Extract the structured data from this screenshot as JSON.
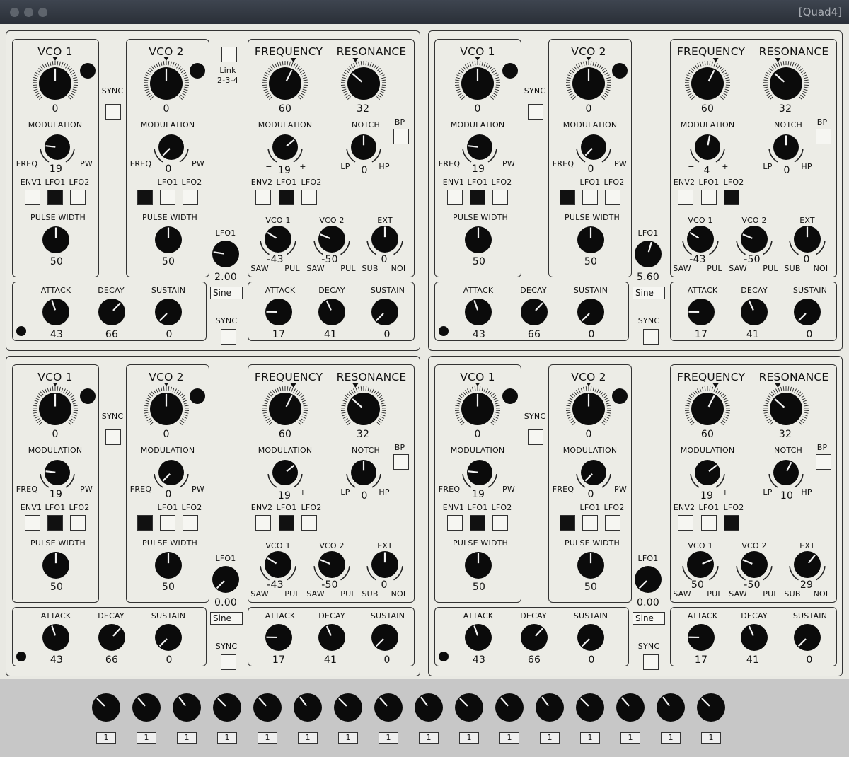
{
  "window": {
    "title": "[Quad4]"
  },
  "labels": {
    "vco1": "VCO 1",
    "vco2": "VCO 2",
    "sync": "SYNC",
    "modulation": "MODULATION",
    "freq": "FREQ",
    "pw": "PW",
    "env1": "ENV1",
    "env2": "ENV2",
    "lfo1": "LFO1",
    "lfo2": "LFO2",
    "pulse_width": "PULSE WIDTH",
    "frequency": "FREQUENCY",
    "resonance": "RESONANCE",
    "notch": "NOTCH",
    "bp": "BP",
    "minus": "−",
    "plus": "+",
    "lp": "LP",
    "hp": "HP",
    "ext": "EXT",
    "saw": "SAW",
    "pul": "PUL",
    "sub": "SUB",
    "noi": "NOI",
    "attack": "ATTACK",
    "decay": "DECAY",
    "sustain": "SUSTAIN",
    "link": "Link",
    "link_sub": "2-3-4"
  },
  "voices": [
    {
      "vco1": "0",
      "vco2": "0",
      "mod1": "19",
      "mod2": "0",
      "pw1": "50",
      "pw2": "50",
      "mod1_src": [
        false,
        true,
        false
      ],
      "mod2_src": [
        true,
        false,
        false
      ],
      "freq": "60",
      "res": "32",
      "fmod": "19",
      "notch": "0",
      "fsrc": [
        false,
        true,
        false
      ],
      "mix_vco1": "-43",
      "mix_vco2": "-50",
      "mix_ext": "0",
      "env1": [
        "43",
        "66",
        "0"
      ],
      "env2": [
        "17",
        "41",
        "0"
      ],
      "lfo_rate": "2.00",
      "lfo_shape": "Sine",
      "lfo_label": "LFO1",
      "sync": "SYNC"
    },
    {
      "vco1": "0",
      "vco2": "0",
      "mod1": "19",
      "mod2": "0",
      "pw1": "50",
      "pw2": "50",
      "mod1_src": [
        false,
        true,
        false
      ],
      "mod2_src": [
        true,
        false,
        false
      ],
      "freq": "60",
      "res": "32",
      "fmod": "4",
      "notch": "0",
      "fsrc": [
        false,
        false,
        true
      ],
      "mix_vco1": "-43",
      "mix_vco2": "-50",
      "mix_ext": "0",
      "env1": [
        "43",
        "66",
        "0"
      ],
      "env2": [
        "17",
        "41",
        "0"
      ],
      "lfo_rate": "5.60",
      "lfo_shape": "Sine",
      "lfo_label": "LFO1",
      "sync": "SYNC"
    },
    {
      "vco1": "0",
      "vco2": "0",
      "mod1": "19",
      "mod2": "0",
      "pw1": "50",
      "pw2": "50",
      "mod1_src": [
        false,
        true,
        false
      ],
      "mod2_src": [
        true,
        false,
        false
      ],
      "freq": "60",
      "res": "32",
      "fmod": "19",
      "notch": "0",
      "fsrc": [
        false,
        true,
        false
      ],
      "mix_vco1": "-43",
      "mix_vco2": "-50",
      "mix_ext": "0",
      "env1": [
        "43",
        "66",
        "0"
      ],
      "env2": [
        "17",
        "41",
        "0"
      ],
      "lfo_rate": "0.00",
      "lfo_shape": "Sine",
      "lfo_label": "LFO1",
      "sync": "SYNC"
    },
    {
      "vco1": "0",
      "vco2": "0",
      "mod1": "19",
      "mod2": "0",
      "pw1": "50",
      "pw2": "50",
      "mod1_src": [
        false,
        true,
        false
      ],
      "mod2_src": [
        true,
        false,
        false
      ],
      "freq": "60",
      "res": "32",
      "fmod": "19",
      "notch": "10",
      "fsrc": [
        false,
        false,
        true
      ],
      "mix_vco1": "50",
      "mix_vco2": "-50",
      "mix_ext": "29",
      "env1": [
        "43",
        "66",
        "0"
      ],
      "env2": [
        "17",
        "41",
        "0"
      ],
      "lfo_rate": "0.00",
      "lfo_shape": "Sine",
      "lfo_label": "LFO1",
      "sync": "SYNC"
    }
  ],
  "bottom": {
    "values": [
      "1",
      "1",
      "1",
      "1",
      "1",
      "1",
      "1",
      "1",
      "1",
      "1",
      "1",
      "1",
      "1",
      "1",
      "1",
      "1"
    ]
  }
}
